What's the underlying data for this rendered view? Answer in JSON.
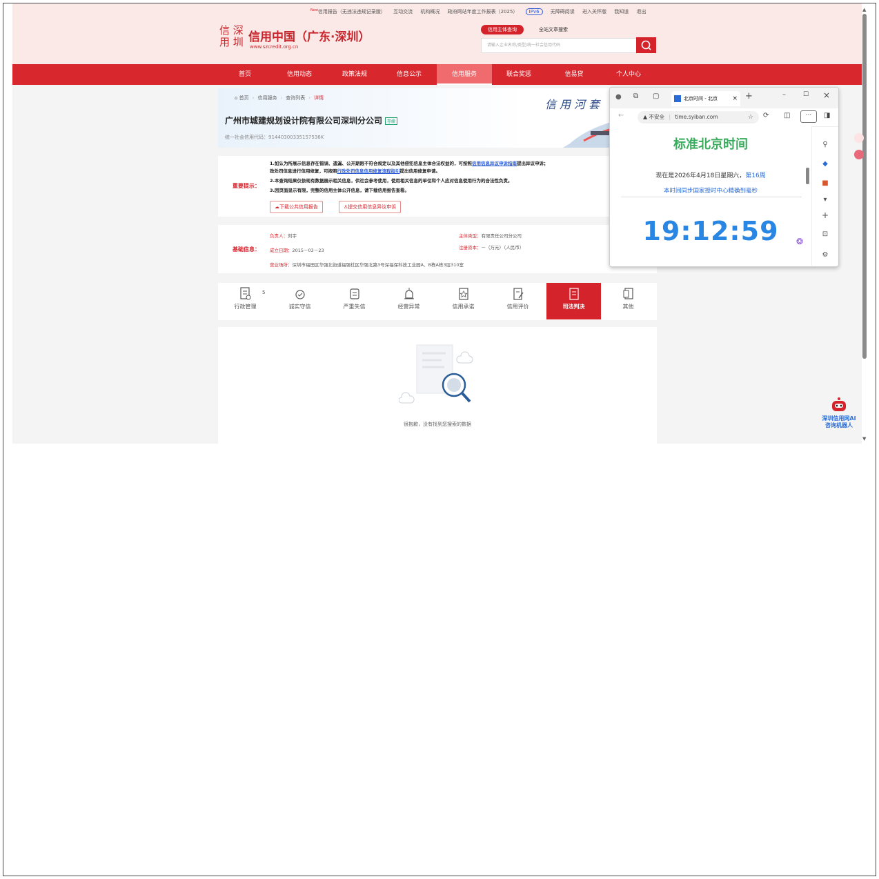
{
  "top_links": {
    "new_badge": "New",
    "items": [
      "信用报告（无违法违规记录版）",
      "互动交流",
      "机构概况",
      "政府网站年度工作报表（2025）",
      "IPv6",
      "无障碍阅读",
      "进入关怀版",
      "我知道",
      "退出"
    ]
  },
  "site": {
    "logo_mark_line1": "信 深",
    "logo_mark_line2": "用 圳",
    "title": "信用中国（广东·深圳）",
    "url": "www.szcredit.org.cn",
    "accent_color": "#d4232b"
  },
  "search": {
    "tab_active": "信用主体查询",
    "tab_other": "全站文章搜索",
    "placeholder": "请输入企业名称/类型/统一社会信用代码"
  },
  "nav": {
    "items": [
      "首页",
      "信用动态",
      "政策法规",
      "信息公示",
      "信用服务",
      "联合奖惩",
      "信易贷",
      "个人中心"
    ],
    "active_index": 4
  },
  "breadcrumb": {
    "items": [
      "首页",
      "信用服务",
      "查询列表"
    ],
    "current": "详情"
  },
  "company": {
    "name": "广州市城建规划设计院有限公司深圳分公司",
    "status_tag": "存续",
    "credit_code_label": "统一社会信用代码：",
    "credit_code": "91440300335157536K",
    "banner_text": "信用河套"
  },
  "notice": {
    "label": "重要提示：",
    "line1_a": "1.如认为所展示信息存在错误、遗漏、公开期限不符合规定以及其他侵犯信息主体合法权益的，可按照",
    "line1_link": "信用信息异议申诉指南",
    "line1_b": "提出异议申诉；",
    "line1c_a": "政处罚信息进行信用修复，可按照",
    "line1c_link": "行政处罚信息信用修复流程指引",
    "line1c_b": "提出信用修复申请。",
    "line2": "2.本查询结果仅依现有数据展示相关信息，供社会参考使用，使用相关信息的单位和个人应对信息使用行为的合法性负责。",
    "line3": "3.因页面显示有限，完整的信用主体公开信息，请下载信用报告查看。",
    "btn_download": "下载公共信用报告",
    "btn_objection": "提交信用信息异议申诉"
  },
  "basic": {
    "label": "基础信息：",
    "legal_rep_label": "负责人：",
    "legal_rep": "刘宇",
    "entity_type_label": "主体类型：",
    "entity_type": "有限责任公司分公司",
    "established_label": "成立日期：",
    "established": "2015－03－23",
    "reg_capital_label": "注册资本：",
    "reg_capital": "－（万元）（人民币）",
    "address_label": "营业场所：",
    "address": "深圳市福田区华强北街道福强社区华强北路3号深福保科技工业园A、B栋A栋3层310室"
  },
  "category_tabs": {
    "items": [
      "行政管理",
      "诚实守信",
      "严重失信",
      "经营异常",
      "信用承诺",
      "信用评价",
      "司法判决",
      "其他"
    ],
    "first_count": "5",
    "active_index": 6
  },
  "empty_state": {
    "message": "很抱歉，没有找到您搜索的数据"
  },
  "popup": {
    "tab_title": "北京时间 - 北京",
    "security_label": "不安全",
    "address": "time.syiban.com",
    "heading": "标准北京时间",
    "date_prefix": "现在是2026年4月18日星期六，",
    "week": "第16周",
    "sync_text": "本时间同步国家授时中心精确到毫秒",
    "time": "19:12:59"
  },
  "robot": {
    "label_line1": "深圳信用网AI",
    "label_line2": "咨询机器人"
  }
}
